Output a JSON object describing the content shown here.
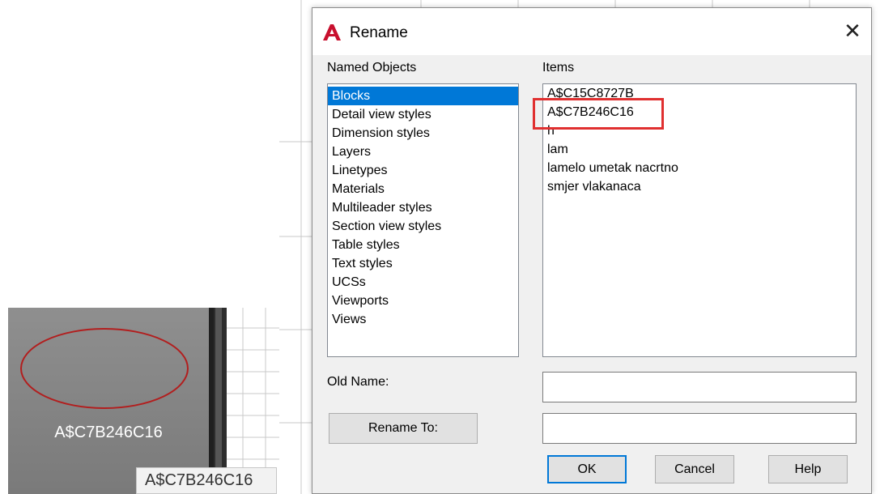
{
  "dialog": {
    "title": "Rename",
    "close_glyph": "✕",
    "named_objects_label": "Named Objects",
    "items_label": "Items",
    "named_objects": [
      "Blocks",
      "Detail view styles",
      "Dimension styles",
      "Layers",
      "Linetypes",
      "Materials",
      "Multileader styles",
      "Section view styles",
      "Table styles",
      "Text styles",
      "UCSs",
      "Viewports",
      "Views"
    ],
    "selected_named_object": "Blocks",
    "items": [
      "A$C15C8727B",
      "A$C7B246C16",
      "h",
      "lam",
      "lamelo umetak nacrtno",
      "smjer vlakanaca"
    ],
    "highlighted_item": "A$C7B246C16",
    "old_name_label": "Old Name:",
    "old_name_value": "",
    "rename_to_label": "Rename To:",
    "rename_to_value": "",
    "ok_label": "OK",
    "cancel_label": "Cancel",
    "help_label": "Help"
  },
  "thumbnail": {
    "label": "A$C7B246C16",
    "tooltip": "A$C7B246C16"
  },
  "colors": {
    "selection": "#0078d7",
    "highlight_box": "#e03030",
    "ellipse_stroke": "#b21e1e",
    "autocad_logo": "#c8102e"
  },
  "icons": {
    "app": "autocad-logo-icon",
    "close": "close-icon"
  }
}
